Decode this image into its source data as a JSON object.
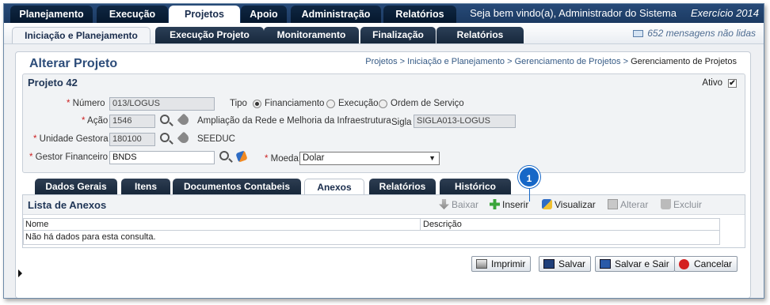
{
  "top_menu": [
    {
      "label": "Planejamento"
    },
    {
      "label": "Execução"
    },
    {
      "label": "Projetos",
      "active": true
    },
    {
      "label": "Apoio"
    },
    {
      "label": "Administração"
    },
    {
      "label": "Relatórios"
    }
  ],
  "welcome": "Seja bem vindo(a), Administrador do Sistema",
  "exercicio": "Exercício 2014",
  "sub_menu": [
    {
      "label": "Iniciação e Planejamento",
      "active": true
    },
    {
      "label": "Execução Projeto"
    },
    {
      "label": "Monitoramento"
    },
    {
      "label": "Finalização"
    },
    {
      "label": "Relatórios"
    }
  ],
  "messages": "652 mensagens não lidas",
  "page_title": "Alterar Projeto",
  "breadcrumb": {
    "links": [
      "Projetos",
      "Iniciação e Planejamento",
      "Gerenciamento de Projetos"
    ],
    "separator": " > ",
    "current": "Gerenciamento de Projetos"
  },
  "project": {
    "title": "Projeto 42",
    "ativo_label": "Ativo",
    "ativo_checked": true,
    "numero_label": "Número",
    "numero_value": "013/LOGUS",
    "tipo_label": "Tipo",
    "tipo_options": [
      "Financiamento",
      "Execução",
      "Ordem de Serviço"
    ],
    "tipo_selected": "Financiamento",
    "acao_label": "Ação",
    "acao_value": "1546",
    "acao_desc": "Ampliação da Rede e Melhoria da Infraestrutura",
    "sigla_label": "Sigla",
    "sigla_value": "SIGLA013-LOGUS",
    "unidade_label": "Unidade Gestora",
    "unidade_value": "180100",
    "unidade_desc": "SEEDUC",
    "gestor_label": "Gestor Financeiro",
    "gestor_value": "BNDS",
    "moeda_label": "Moeda",
    "moeda_value": "Dolar"
  },
  "lower_tabs": [
    {
      "label": "Dados Gerais"
    },
    {
      "label": "Itens"
    },
    {
      "label": "Documentos Contabeis"
    },
    {
      "label": "Anexos",
      "active": true
    },
    {
      "label": "Relatórios"
    },
    {
      "label": "Histórico"
    }
  ],
  "anexos": {
    "title": "Lista de Anexos",
    "toolbar": {
      "baixar": "Baixar",
      "inserir": "Inserir",
      "visualizar": "Visualizar",
      "alterar": "Alterar",
      "excluir": "Excluir"
    },
    "columns": [
      "Nome",
      "Descrição"
    ],
    "empty_message": "Não há dados para esta consulta."
  },
  "buttons": {
    "imprimir": "Imprimir",
    "salvar": "Salvar",
    "salvar_sair": "Salvar e Sair",
    "cancelar": "Cancelar"
  },
  "callout": "1",
  "colors": {
    "nav_dark": "#1c3a62",
    "title_blue": "#2d4d7a",
    "callout_blue": "#1667c7"
  }
}
